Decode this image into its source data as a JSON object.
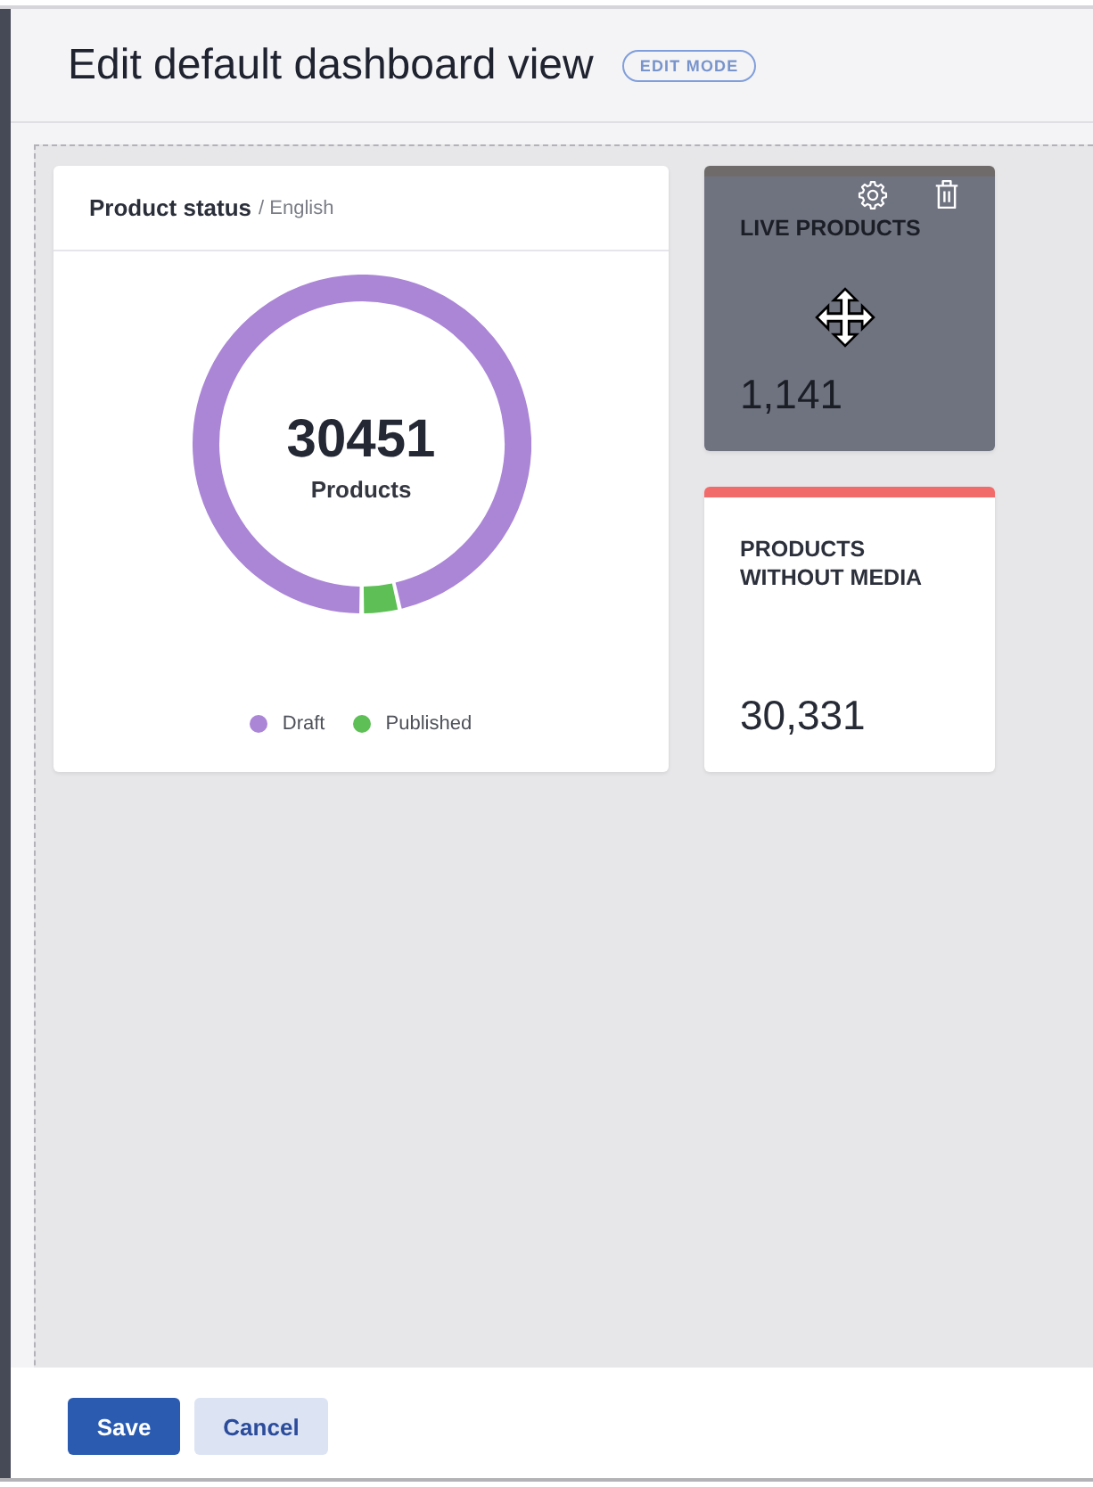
{
  "page": {
    "title": "Edit default dashboard view",
    "mode_badge": "EDIT MODE"
  },
  "widgets": [
    {
      "kind": "chart",
      "title": "Product status",
      "subtitle": "/ English",
      "total": "30451",
      "total_label": "Products",
      "legend": [
        {
          "label": "Draft",
          "color": "#ab85d6"
        },
        {
          "label": "Published",
          "color": "#5dbf55"
        }
      ]
    },
    {
      "kind": "stat",
      "title": "LIVE PRODUCTS",
      "value": "1,141",
      "color": "#6f6b6a",
      "hovered": true
    },
    {
      "kind": "stat",
      "title": "PRODUCTS WITHOUT MEDIA",
      "value": "30,331",
      "color": "#f26b6b",
      "hovered": false
    }
  ],
  "footer": {
    "buttons": [
      {
        "label": "Save",
        "kind": "primary"
      },
      {
        "label": "Cancel",
        "kind": "secondary"
      }
    ]
  }
}
